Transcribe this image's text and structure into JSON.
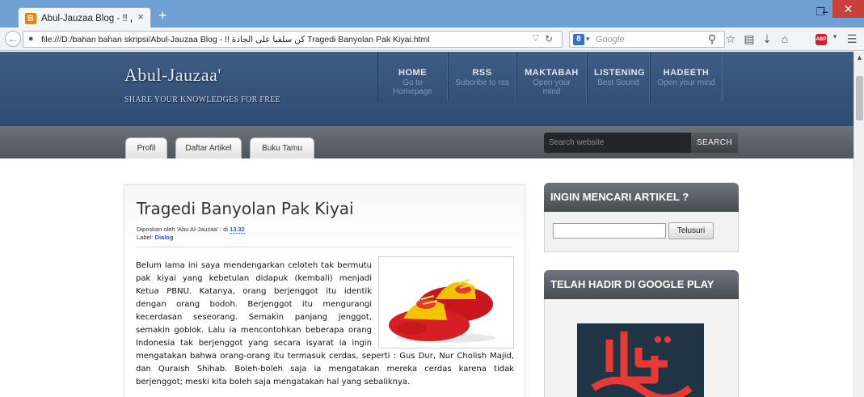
{
  "browser": {
    "tab_title": "Abul-Jauzaa Blog - !! كن ...",
    "tab_close": "×",
    "new_tab": "+",
    "url": "file:///D:/bahan bahan skripsi/Abul-Jauzaa Blog - !! كن سلفياً على الجادة  Tragedi Banyolan Pak Kiyai.html",
    "search_placeholder": "Google",
    "search_engine_letter": "8",
    "win_min": "–",
    "win_max": "❐",
    "win_close": "✕"
  },
  "site": {
    "title": "Abul-Jauzaa'",
    "tagline": "SHARE YOUR KNOWLEDGES FOR FREE",
    "menu": [
      {
        "title": "HOME",
        "sub": "Go to Homepage"
      },
      {
        "title": "RSS",
        "sub": "Subcribe to rss"
      },
      {
        "title": "MAKTABAH",
        "sub": "Open your mind"
      },
      {
        "title": "LISTENING",
        "sub": "Best Sound"
      },
      {
        "title": "HADEETH",
        "sub": "Open your mind"
      }
    ],
    "tabs": [
      "Profil",
      "Daftar Artikel",
      "Buku Tamu"
    ],
    "search_placeholder": "Search website",
    "search_button": "SEARCH"
  },
  "post": {
    "title": "Tragedi Banyolan Pak Kiyai",
    "meta_prefix": "Diposkan oleh 'Abu Al-Jauzaa' : di ",
    "meta_time": "13.32",
    "label_prefix": "Label: ",
    "label": "Dialog",
    "body": "Belum lama ini saya mendengarkan celoteh tak bermutu pak kiyai yang kebetulan didapuk (kembali) menjadi Ketua PBNU. Katanya, orang berjenggot itu identik dengan orang bodoh. Berjenggot itu mengurangi kecerdasan seseorang. Semakin panjang jenggot, semakin goblok. Lalu ia mencontohkan beberapa orang Indonesia tak berjenggot yang secara isyarat ia ingin mengatakan bahwa orang-orang itu termasuk cerdas, seperti : Gus Dur, Nur Cholish Majid, dan Quraish Shihab. Boleh-boleh saja ia mengatakan mereka cerdas karena tidak berjenggot; meski kita boleh saja mengatakan hal yang sebaliknya."
  },
  "sidebar": {
    "search_widget_title": "INGIN MENCARI ARTIKEL ?",
    "search_button": "Telusuri",
    "play_widget_title": "TELAH HADIR DI GOOGLE PLAY"
  },
  "colors": {
    "header": "#34507a",
    "subnav": "#5c6269",
    "accent_link": "#2a5ab3"
  }
}
